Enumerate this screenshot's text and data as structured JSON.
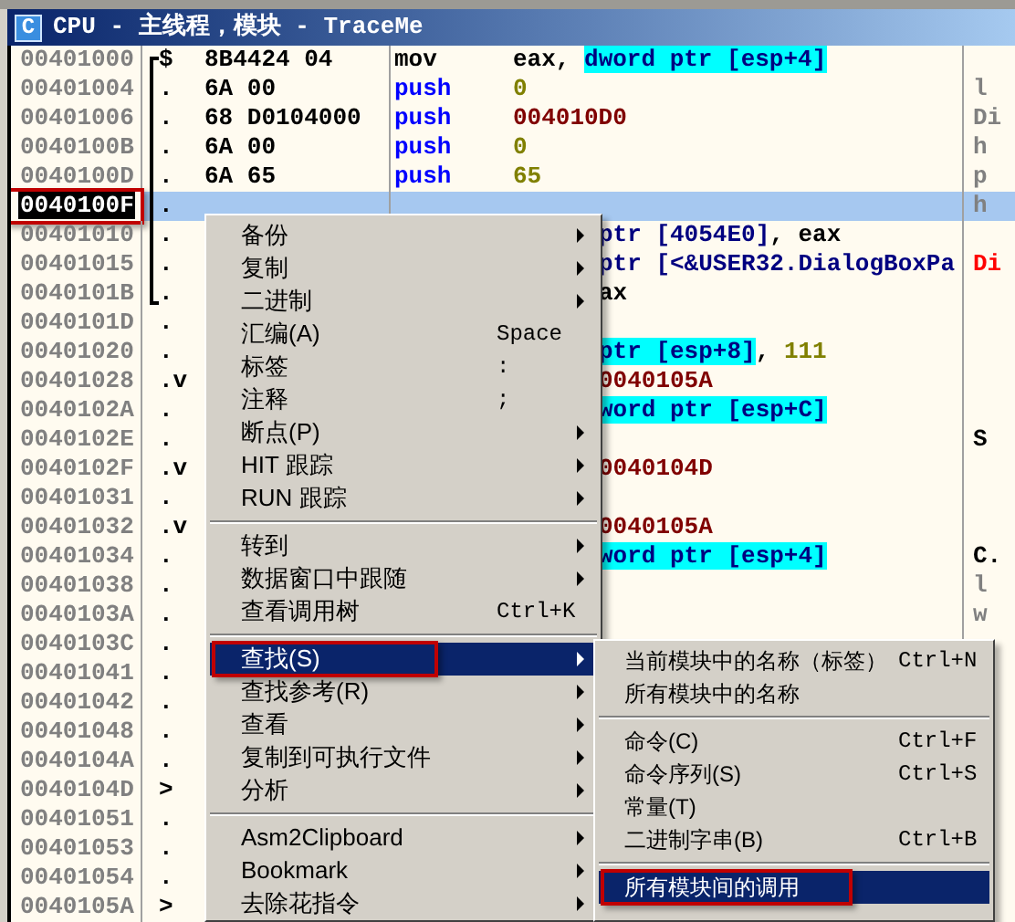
{
  "window": {
    "icon_letter": "C",
    "title": "CPU - 主线程，模块 - TraceMe"
  },
  "rows": [
    {
      "address": "00401000",
      "mark": "$",
      "hex": "8B4424 04",
      "mnemonic": {
        "text": "mov",
        "kind": "plain"
      },
      "operand": [
        {
          "text": "eax, ",
          "kind": "plain"
        },
        {
          "text": "dword ptr [esp+4]",
          "kind": "mem"
        }
      ],
      "selected": false,
      "highlighted": false
    },
    {
      "address": "00401004",
      "mark": ".",
      "hex": "6A 00",
      "mnemonic": {
        "text": "push",
        "kind": "stack"
      },
      "operand": [
        {
          "text": "0",
          "kind": "const"
        }
      ],
      "comment": {
        "text": "l",
        "kind": "arg"
      },
      "selected": false,
      "highlighted": false
    },
    {
      "address": "00401006",
      "mark": ".",
      "hex": "68 D0104000",
      "mnemonic": {
        "text": "push",
        "kind": "stack"
      },
      "operand": [
        {
          "text": "004010D0",
          "kind": "addr"
        }
      ],
      "comment": {
        "text": "Di",
        "kind": "arg"
      },
      "selected": false,
      "highlighted": false
    },
    {
      "address": "0040100B",
      "mark": ".",
      "hex": "6A 00",
      "mnemonic": {
        "text": "push",
        "kind": "stack"
      },
      "operand": [
        {
          "text": "0",
          "kind": "const"
        }
      ],
      "comment": {
        "text": "h",
        "kind": "arg"
      },
      "selected": false,
      "highlighted": false
    },
    {
      "address": "0040100D",
      "mark": ".",
      "hex": "6A 65",
      "mnemonic": {
        "text": "push",
        "kind": "stack"
      },
      "operand": [
        {
          "text": "65",
          "kind": "const"
        }
      ],
      "comment": {
        "text": "p",
        "kind": "arg"
      },
      "selected": false,
      "highlighted": false
    },
    {
      "address": "0040100F",
      "mark": ".",
      "comment": {
        "text": "h",
        "kind": "arg"
      },
      "selected": true,
      "highlighted": true
    },
    {
      "address": "00401010",
      "mark": ".",
      "operand_tail": [
        {
          "text": "ptr [4054E0]",
          "kind": "ref"
        },
        {
          "text": ", eax",
          "kind": "plain"
        }
      ],
      "selected": false,
      "highlighted": false
    },
    {
      "address": "00401015",
      "mark": ".",
      "operand_tail": [
        {
          "text": "ptr [<&USER32.DialogBoxPa",
          "kind": "ref"
        }
      ],
      "comment": {
        "text": "Di",
        "kind": "call"
      },
      "selected": false,
      "highlighted": false
    },
    {
      "address": "0040101B",
      "mark": ".",
      "operand_tail": [
        {
          "text": "ax",
          "kind": "plain"
        }
      ],
      "selected": false,
      "highlighted": false
    },
    {
      "address": "0040101D",
      "mark": ".",
      "selected": false,
      "highlighted": false
    },
    {
      "address": "00401020",
      "mark": ".",
      "operand_tail": [
        {
          "text": "ptr [esp+8]",
          "kind": "mem"
        },
        {
          "text": ", ",
          "kind": "plain"
        },
        {
          "text": "111",
          "kind": "const"
        }
      ],
      "selected": false,
      "highlighted": false
    },
    {
      "address": "00401028",
      "mark": ".v",
      "operand_tail": [
        {
          "text": "0040105A",
          "kind": "addr"
        }
      ],
      "selected": false,
      "highlighted": false
    },
    {
      "address": "0040102A",
      "mark": ".",
      "operand_tail": [
        {
          "text": "word ptr [esp+C]",
          "kind": "mem"
        }
      ],
      "selected": false,
      "highlighted": false
    },
    {
      "address": "0040102E",
      "mark": ".",
      "comment": {
        "text": "S",
        "kind": "head"
      },
      "selected": false,
      "highlighted": false
    },
    {
      "address": "0040102F",
      "mark": ".v",
      "operand_tail": [
        {
          "text": "0040104D",
          "kind": "addr"
        }
      ],
      "selected": false,
      "highlighted": false
    },
    {
      "address": "00401031",
      "mark": ".",
      "selected": false,
      "highlighted": false
    },
    {
      "address": "00401032",
      "mark": ".v",
      "operand_tail": [
        {
          "text": "0040105A",
          "kind": "addr"
        }
      ],
      "selected": false,
      "highlighted": false
    },
    {
      "address": "00401034",
      "mark": ".",
      "operand_tail": [
        {
          "text": "word ptr [esp+4]",
          "kind": "mem"
        }
      ],
      "comment": {
        "text": "C.",
        "kind": "head"
      },
      "selected": false,
      "highlighted": false
    },
    {
      "address": "00401038",
      "mark": ".",
      "comment": {
        "text": "l",
        "kind": "arg"
      },
      "selected": false,
      "highlighted": false
    },
    {
      "address": "0040103A",
      "mark": ".",
      "comment": {
        "text": "w",
        "kind": "arg"
      },
      "selected": false,
      "highlighted": false
    },
    {
      "address": "0040103C",
      "mark": ".",
      "selected": false,
      "highlighted": false
    },
    {
      "address": "00401041",
      "mark": ".",
      "selected": false,
      "highlighted": false
    },
    {
      "address": "00401042",
      "mark": ".",
      "selected": false,
      "highlighted": false
    },
    {
      "address": "00401048",
      "mark": ".",
      "selected": false,
      "highlighted": false
    },
    {
      "address": "0040104A",
      "mark": ".",
      "selected": false,
      "highlighted": false
    },
    {
      "address": "0040104D",
      "mark": ">",
      "selected": false,
      "highlighted": false
    },
    {
      "address": "00401051",
      "mark": ".",
      "selected": false,
      "highlighted": false
    },
    {
      "address": "00401053",
      "mark": ".",
      "selected": false,
      "highlighted": false
    },
    {
      "address": "00401054",
      "mark": ".",
      "selected": false,
      "highlighted": false
    },
    {
      "address": "0040105A",
      "mark": ">",
      "selected": false,
      "highlighted": false
    }
  ],
  "context_menu": {
    "items": [
      {
        "kind": "item",
        "label": "备份",
        "submenu": true,
        "selected": false,
        "highlighted": false
      },
      {
        "kind": "item",
        "label": "复制",
        "submenu": true,
        "selected": false,
        "highlighted": false
      },
      {
        "kind": "item",
        "label": "二进制",
        "submenu": true,
        "selected": false,
        "highlighted": false
      },
      {
        "kind": "item",
        "label": "汇编(A)",
        "shortcut": "Space",
        "submenu": false,
        "selected": false,
        "highlighted": false
      },
      {
        "kind": "item",
        "label": "标签",
        "shortcut": ":",
        "submenu": false,
        "selected": false,
        "highlighted": false
      },
      {
        "kind": "item",
        "label": "注释",
        "shortcut": ";",
        "submenu": false,
        "selected": false,
        "highlighted": false
      },
      {
        "kind": "item",
        "label": "断点(P)",
        "submenu": true,
        "selected": false,
        "highlighted": false
      },
      {
        "kind": "item",
        "label": "HIT 跟踪",
        "submenu": true,
        "selected": false,
        "highlighted": false
      },
      {
        "kind": "item",
        "label": "RUN 跟踪",
        "submenu": true,
        "selected": false,
        "highlighted": false
      },
      {
        "kind": "separator"
      },
      {
        "kind": "item",
        "label": "转到",
        "submenu": true,
        "selected": false,
        "highlighted": false
      },
      {
        "kind": "item",
        "label": "数据窗口中跟随",
        "submenu": true,
        "selected": false,
        "highlighted": false
      },
      {
        "kind": "item",
        "label": "查看调用树",
        "shortcut": "Ctrl+K",
        "submenu": false,
        "selected": false,
        "highlighted": false
      },
      {
        "kind": "separator"
      },
      {
        "kind": "item",
        "label": "查找(S)",
        "submenu": true,
        "selected": true,
        "highlighted": true
      },
      {
        "kind": "item",
        "label": "查找参考(R)",
        "submenu": true,
        "selected": false,
        "highlighted": false
      },
      {
        "kind": "item",
        "label": "查看",
        "submenu": true,
        "selected": false,
        "highlighted": false
      },
      {
        "kind": "item",
        "label": "复制到可执行文件",
        "submenu": true,
        "selected": false,
        "highlighted": false
      },
      {
        "kind": "item",
        "label": "分析",
        "submenu": true,
        "selected": false,
        "highlighted": false
      },
      {
        "kind": "separator"
      },
      {
        "kind": "item",
        "label": "Asm2Clipboard",
        "submenu": true,
        "selected": false,
        "highlighted": false
      },
      {
        "kind": "item",
        "label": "Bookmark",
        "submenu": true,
        "selected": false,
        "highlighted": false
      },
      {
        "kind": "item",
        "label": "去除花指令",
        "submenu": true,
        "selected": false,
        "highlighted": false
      }
    ]
  },
  "submenu": {
    "items": [
      {
        "kind": "item",
        "label": "当前模块中的名称（标签）",
        "shortcut": "Ctrl+N",
        "selected": false,
        "highlighted": false
      },
      {
        "kind": "item",
        "label": "所有模块中的名称",
        "selected": false,
        "highlighted": false
      },
      {
        "kind": "separator"
      },
      {
        "kind": "item",
        "label": "命令(C)",
        "shortcut": "Ctrl+F",
        "selected": false,
        "highlighted": false
      },
      {
        "kind": "item",
        "label": "命令序列(S)",
        "shortcut": "Ctrl+S",
        "selected": false,
        "highlighted": false
      },
      {
        "kind": "item",
        "label": "常量(T)",
        "selected": false,
        "highlighted": false
      },
      {
        "kind": "item",
        "label": "二进制字串(B)",
        "shortcut": "Ctrl+B",
        "selected": false,
        "highlighted": false
      },
      {
        "kind": "separator"
      },
      {
        "kind": "item",
        "label": "所有模块间的调用",
        "selected": true,
        "highlighted": true
      }
    ]
  }
}
